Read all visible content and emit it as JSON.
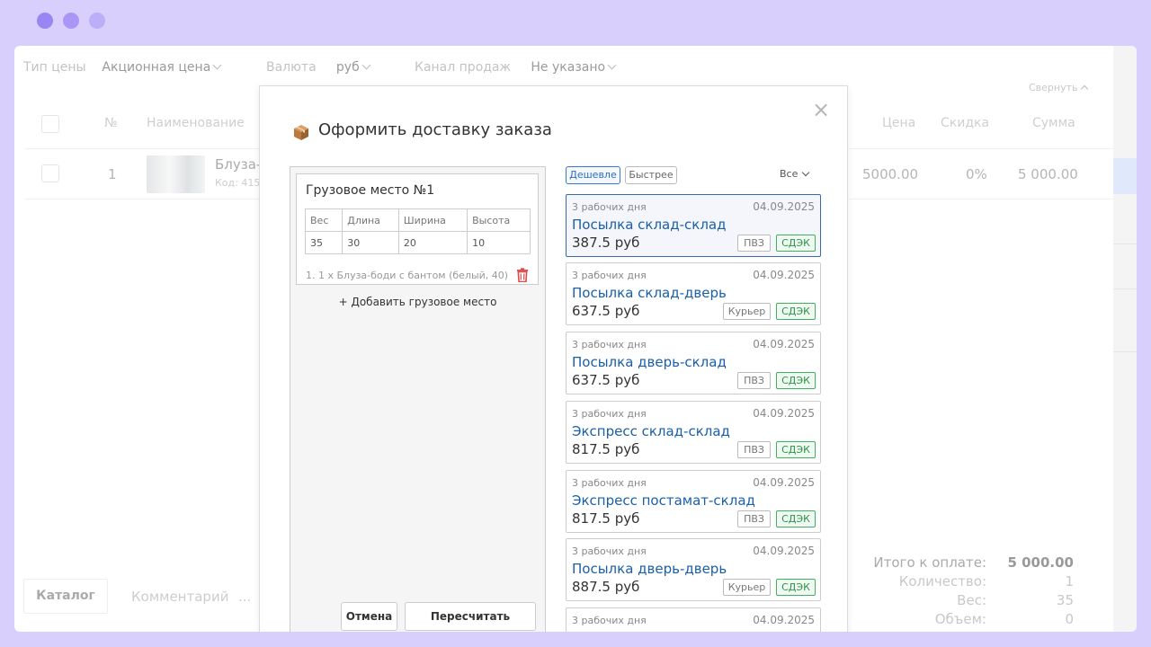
{
  "filters": {
    "price_type_label": "Тип цены",
    "price_type_value": "Акционная цена",
    "currency_label": "Валюта",
    "currency_value": "руб",
    "channel_label": "Канал продаж",
    "channel_value": "Не указано"
  },
  "collapse_label": "Свернуть",
  "table": {
    "headers": [
      "№",
      "Наименование",
      "Цена",
      "Скидка",
      "Сумма"
    ],
    "row": {
      "num": "1",
      "name": "Блуза-б",
      "code": "Код: 415",
      "price": "5000.00",
      "discount": "0%",
      "sum": "5 000.00"
    }
  },
  "bottom_tabs": [
    "Каталог",
    "Комментарий",
    "..."
  ],
  "totals": {
    "total_label": "Итого к оплате:",
    "total_value": "5 000.00",
    "qty_label": "Количество:",
    "qty_value": "1",
    "weight_label": "Вес:",
    "weight_value": "35",
    "volume_label": "Объем:",
    "volume_value": "0"
  },
  "modal": {
    "title": "Оформить доставку заказа",
    "close": "×",
    "cargo": {
      "title": "Грузовое место №1",
      "headers": [
        "Вес",
        "Длина",
        "Ширина",
        "Высота"
      ],
      "values": [
        "35",
        "30",
        "20",
        "10"
      ],
      "item": "1. 1 x Блуза-боди с бантом (белый, 40)"
    },
    "add_cargo": "+ Добавить грузовое место",
    "cancel": "Отмена",
    "recalc": "Пересчитать доставку",
    "sort_cheap": "Дешевле",
    "sort_fast": "Быстрее",
    "filter_all": "Все",
    "offers": [
      {
        "days": "3 рабочих дня",
        "date": "04.09.2025",
        "name": "Посылка склад-склад",
        "price": "387.5 руб",
        "type": "ПВЗ",
        "carrier": "СДЭК"
      },
      {
        "days": "3 рабочих дня",
        "date": "04.09.2025",
        "name": "Посылка склад-дверь",
        "price": "637.5 руб",
        "type": "Курьер",
        "carrier": "СДЭК"
      },
      {
        "days": "3 рабочих дня",
        "date": "04.09.2025",
        "name": "Посылка дверь-склад",
        "price": "637.5 руб",
        "type": "ПВЗ",
        "carrier": "СДЭК"
      },
      {
        "days": "3 рабочих дня",
        "date": "04.09.2025",
        "name": "Экспресс склад-склад",
        "price": "817.5 руб",
        "type": "ПВЗ",
        "carrier": "СДЭК"
      },
      {
        "days": "3 рабочих дня",
        "date": "04.09.2025",
        "name": "Экспресс постамат-склад",
        "price": "817.5 руб",
        "type": "ПВЗ",
        "carrier": "СДЭК"
      },
      {
        "days": "3 рабочих дня",
        "date": "04.09.2025",
        "name": "Посылка дверь-дверь",
        "price": "887.5 руб",
        "type": "Курьер",
        "carrier": "СДЭК"
      },
      {
        "days": "3 рабочих дня",
        "date": "04.09.2025",
        "name": "",
        "price": "",
        "type": "",
        "carrier": ""
      }
    ]
  }
}
